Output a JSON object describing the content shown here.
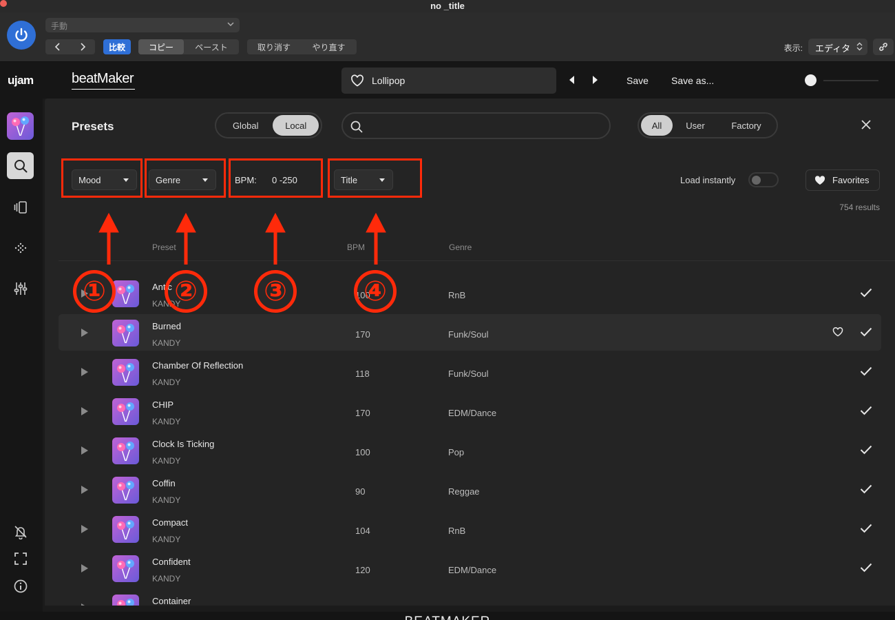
{
  "window": {
    "title": "no _title"
  },
  "host": {
    "mode": "手動",
    "compare": "比較",
    "copy": "コピー",
    "paste": "ペースト",
    "undo": "取り消す",
    "redo": "やり直す",
    "view_label": "表示:",
    "view_value": "エディタ",
    "accent": "#2f6fd6"
  },
  "plugin": {
    "brand": "ujam",
    "product": "beatMaker",
    "current_preset": "Lollipop",
    "save": "Save",
    "save_as": "Save as...",
    "footer": "BEATMAKER"
  },
  "presets": {
    "title": "Presets",
    "location_tabs": [
      "Global",
      "Local"
    ],
    "location_selected": "Local",
    "search_placeholder": "",
    "type_tabs": [
      "All",
      "User",
      "Factory"
    ],
    "type_selected": "All",
    "filters": {
      "mood": "Mood",
      "genre": "Genre",
      "bpm_label": "BPM:",
      "bpm_range": "0  -250",
      "sort": "Title"
    },
    "load_instantly_label": "Load instantly",
    "load_instantly": false,
    "favorites_label": "Favorites",
    "results": "754 results",
    "columns": {
      "preset": "Preset",
      "bpm": "BPM",
      "genre": "Genre"
    },
    "rows": [
      {
        "name": "Antic",
        "author": "KANDY",
        "bpm": "100",
        "genre": "RnB"
      },
      {
        "name": "Burned",
        "author": "KANDY",
        "bpm": "170",
        "genre": "Funk/Soul"
      },
      {
        "name": "Chamber Of Reflection",
        "author": "KANDY",
        "bpm": "118",
        "genre": "Funk/Soul"
      },
      {
        "name": "CHIP",
        "author": "KANDY",
        "bpm": "170",
        "genre": "EDM/Dance"
      },
      {
        "name": "Clock Is Ticking",
        "author": "KANDY",
        "bpm": "100",
        "genre": "Pop"
      },
      {
        "name": "Coffin",
        "author": "KANDY",
        "bpm": "90",
        "genre": "Reggae"
      },
      {
        "name": "Compact",
        "author": "KANDY",
        "bpm": "104",
        "genre": "RnB"
      },
      {
        "name": "Confident",
        "author": "KANDY",
        "bpm": "120",
        "genre": "EDM/Dance"
      },
      {
        "name": "Container",
        "author": "",
        "bpm": "",
        "genre": ""
      }
    ]
  },
  "annotations": {
    "color": "#ff2a0a",
    "labels": [
      "①",
      "②",
      "③",
      "④"
    ]
  }
}
